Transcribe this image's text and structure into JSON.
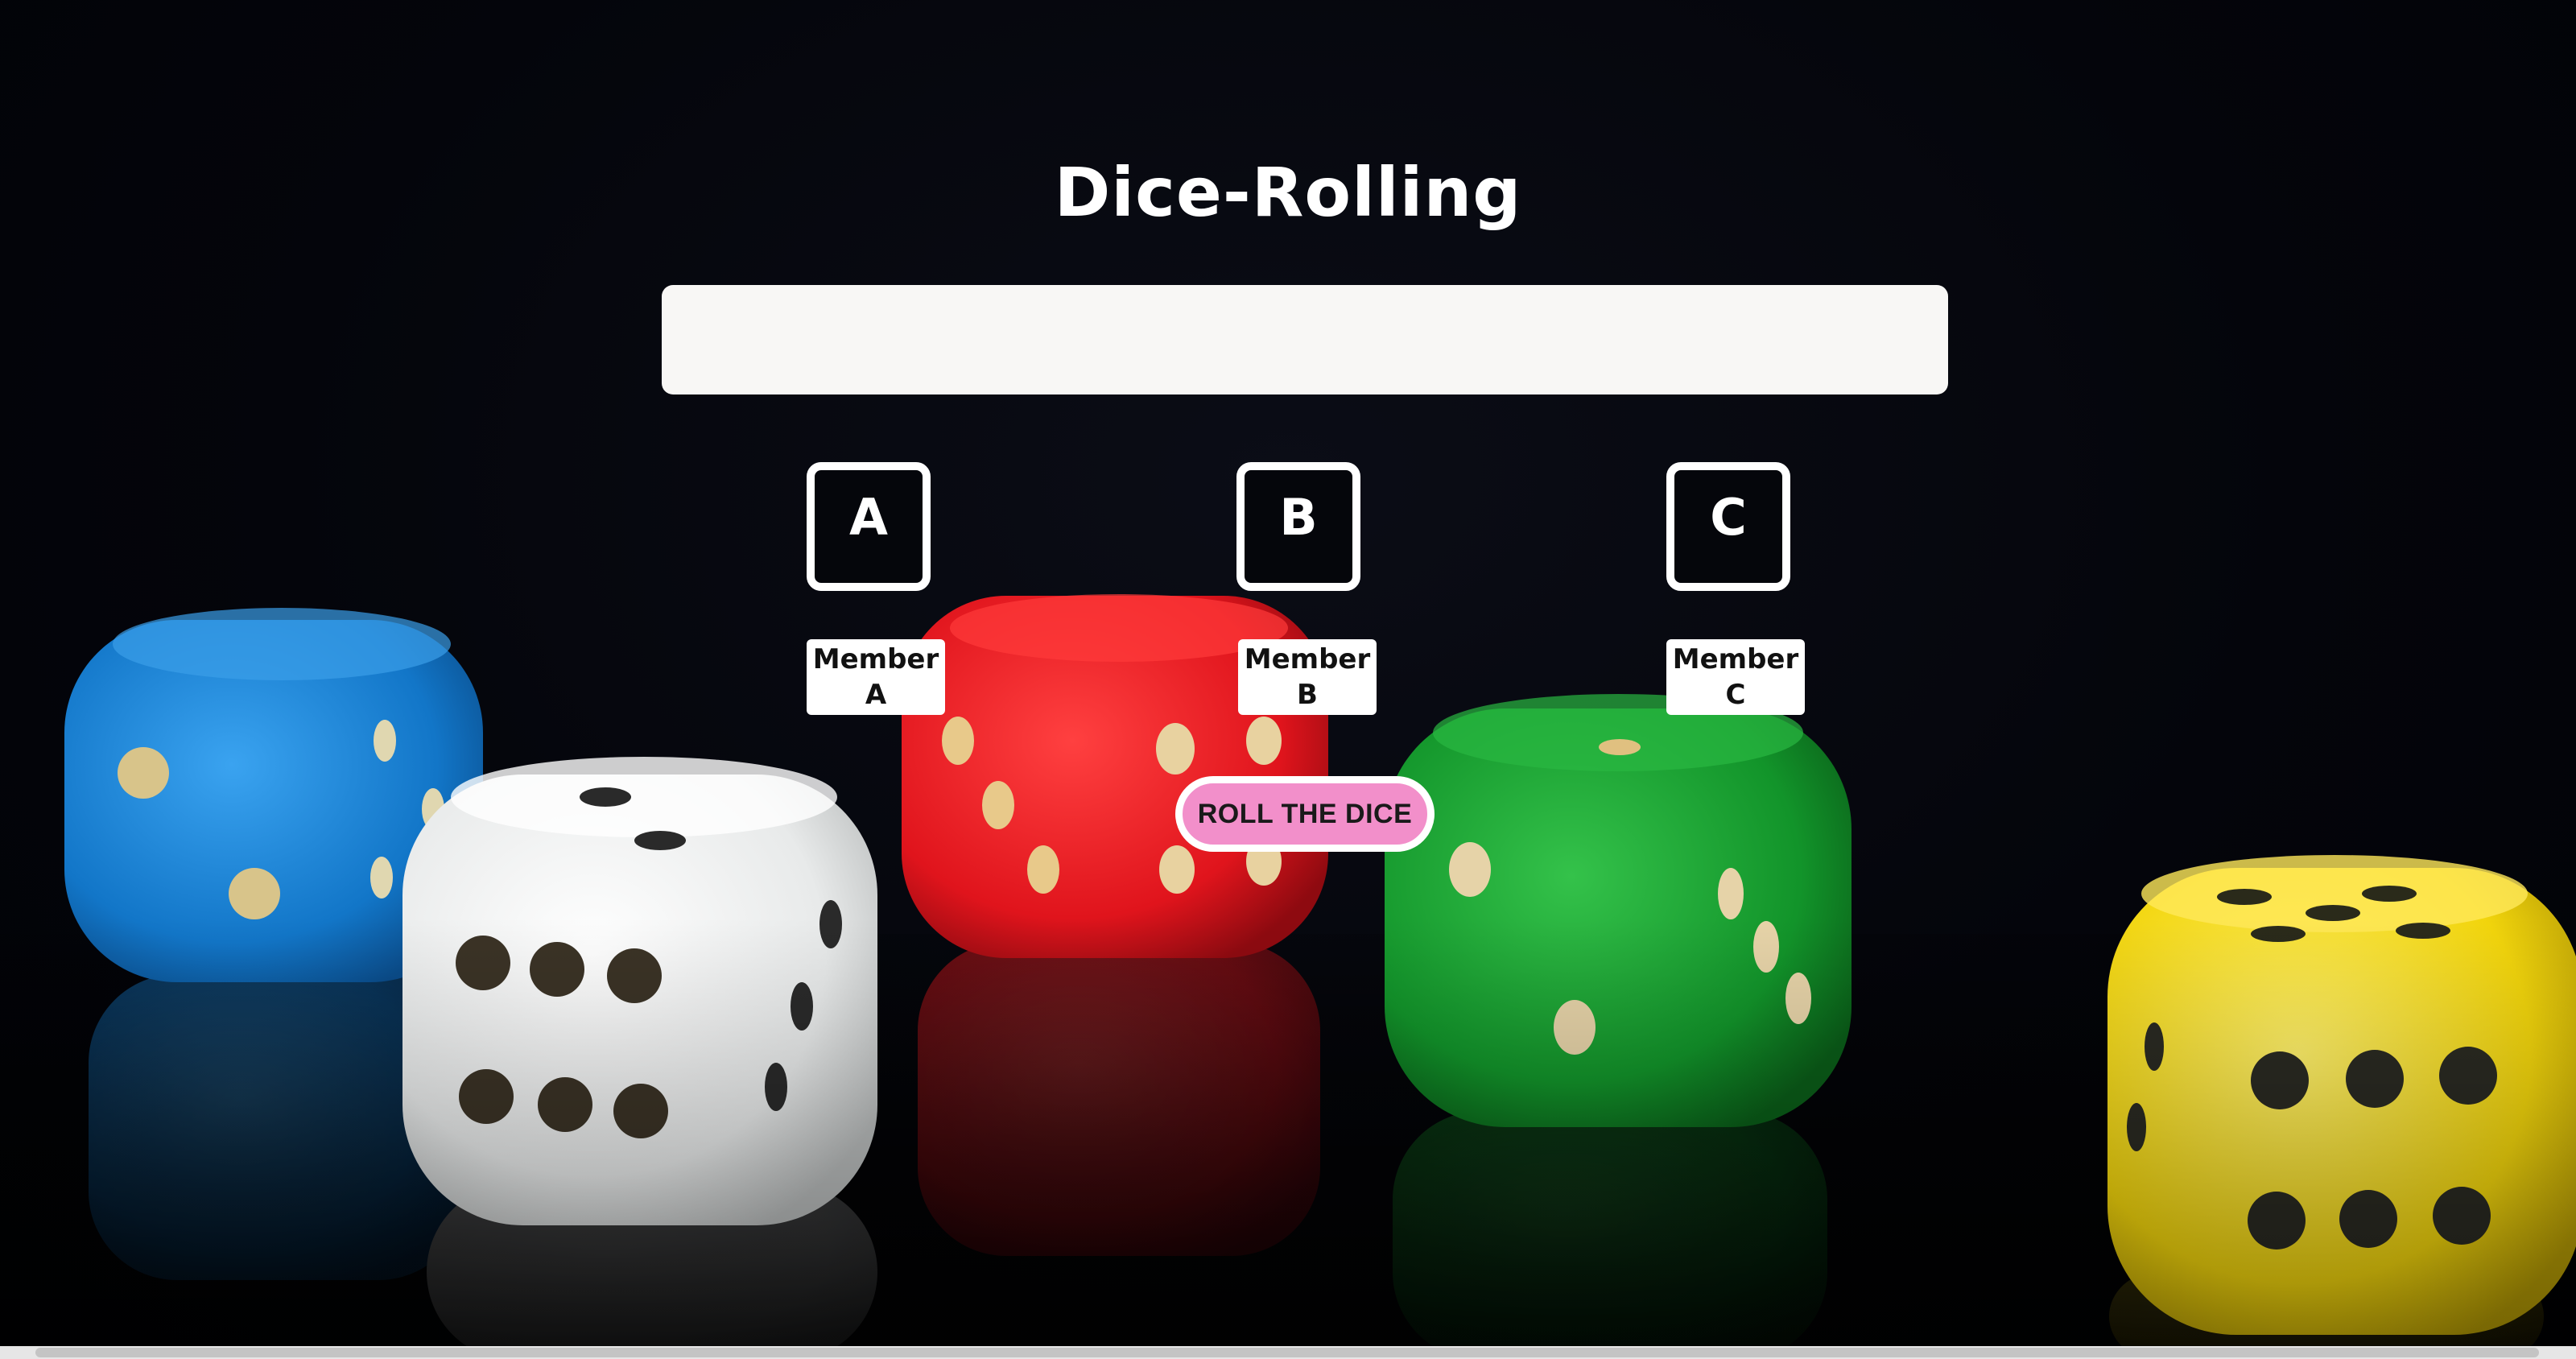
{
  "app": {
    "title": "Dice-Rolling"
  },
  "result_display": {
    "value": ""
  },
  "players": [
    {
      "die_letter": "A",
      "label": "Member A"
    },
    {
      "die_letter": "B",
      "label": "Member B"
    },
    {
      "die_letter": "C",
      "label": "Member C"
    }
  ],
  "actions": {
    "roll_label": "ROLL THE DICE"
  },
  "colors": {
    "background": "#030409",
    "button_fill": "#f28fca",
    "blue_die": "#1a86d8",
    "white_die": "#eceeee",
    "red_die": "#e2141c",
    "green_die": "#139a25",
    "yellow_die": "#f2d80e"
  }
}
